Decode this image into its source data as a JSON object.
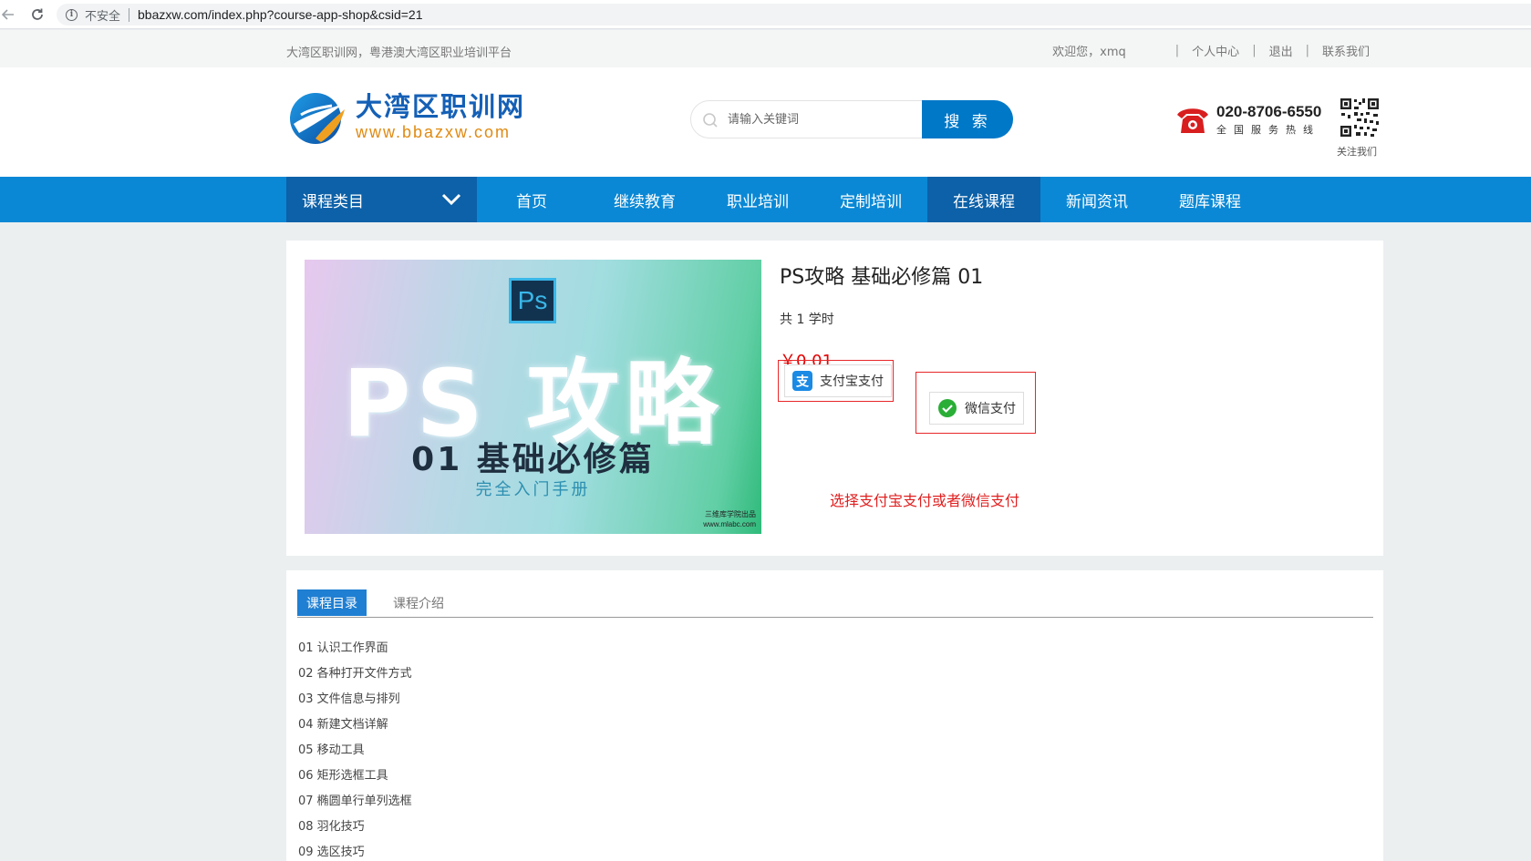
{
  "browser": {
    "insecure_label": "不安全",
    "url": "bbazxw.com/index.php?course-app-shop&csid=21"
  },
  "topbar": {
    "tagline": "大湾区职训网，粤港澳大湾区职业培训平台",
    "welcome": "欢迎您，xmq",
    "links": [
      "个人中心",
      "退出",
      "联系我们"
    ]
  },
  "header": {
    "logo_name": "大湾区职训网",
    "logo_url": "www.bbazxw.com",
    "search_placeholder": "请输入关键词",
    "search_button": "搜 索",
    "hotline_number": "020-8706-6550",
    "hotline_label": "全国服务热线",
    "qr_label": "关注我们"
  },
  "nav": {
    "category_label": "课程类目",
    "items": [
      "首页",
      "继续教育",
      "职业培训",
      "定制培训",
      "在线课程",
      "新闻资讯",
      "题库课程"
    ],
    "active_index": 4
  },
  "course": {
    "thumb": {
      "badge": "Ps",
      "title": "PS 攻略",
      "subtitle": "01 基础必修篇",
      "subtitle2": "完全入门手册",
      "credit_line1": "三维库学院出品",
      "credit_line2": "www.mlabc.com"
    },
    "title": "PS攻略 基础必修篇 01",
    "hours": "共 1 学时",
    "price": "￥0.01",
    "pay_alipay": "支付宝支付",
    "pay_wechat": "微信支付",
    "annotation": "选择支付宝支付或者微信支付"
  },
  "catalog": {
    "tabs": [
      "课程目录",
      "课程介绍"
    ],
    "active_tab": 0,
    "lessons": [
      "01 认识工作界面",
      "02 各种打开文件方式",
      "03 文件信息与排列",
      "04 新建文档详解",
      "05 移动工具",
      "06 矩形选框工具",
      "07 椭圆单行单列选框",
      "08 羽化技巧",
      "09 选区技巧"
    ]
  },
  "colors": {
    "nav_blue": "#0a88d5",
    "nav_dark": "#0c61a8",
    "price_red": "#e40000",
    "annotation_red": "#e8272a"
  }
}
